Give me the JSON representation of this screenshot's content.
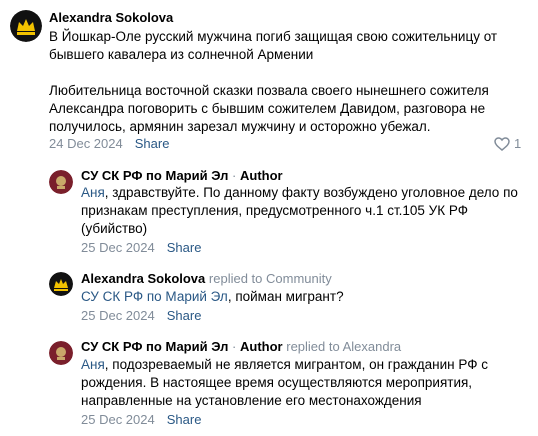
{
  "post": {
    "author": "Alexandra Sokolova",
    "paragraph1": "В Йошкар-Оле русский мужчина погиб защищая свою сожительницу от бывшего кавалера из солнечной Армении",
    "paragraph2": "Любительница восточной сказки позвала своего нынешнего сожителя Александра поговорить с бывшим сожителем Давидом, разговора не получилось, армянин зарезал мужчину и осторожно убежал.",
    "date": "24 Dec 2024",
    "share_label": "Share",
    "like_count": "1"
  },
  "replies": [
    {
      "author": "СУ СК РФ по Марий Эл",
      "separator": "·",
      "role": "Author",
      "reply_to": "",
      "mention": "Аня",
      "text": ", здравствуйте. По данному факту возбуждено уголовное дело по признакам преступления, предусмотренного ч.1 ст.105 УК РФ (убийство)",
      "date": "25 Dec 2024",
      "share_label": "Share"
    },
    {
      "author": "Alexandra Sokolova",
      "separator": "",
      "role": "",
      "reply_to": "replied to Community",
      "mention": "СУ СК РФ по Марий Эл",
      "text": ", пойман мигрант?",
      "date": "25 Dec 2024",
      "share_label": "Share"
    },
    {
      "author": "СУ СК РФ по Марий Эл",
      "separator": "·",
      "role": "Author",
      "reply_to": "replied to Alexandra",
      "mention": "Аня",
      "text": ", подозреваемый не является мигрантом, он гражданин РФ с рождения. В настоящее время осуществляются мероприятия, направленные на установление его местонахождения",
      "date": "25 Dec 2024",
      "share_label": "Share"
    }
  ],
  "colors": {
    "link": "#2a5885",
    "secondary": "#818c99",
    "community_avatar": "#7a1f2b",
    "user_avatar": "#111111",
    "user_avatar_accent": "#f2c200"
  },
  "icons": {
    "like": "heart-outline-icon"
  }
}
